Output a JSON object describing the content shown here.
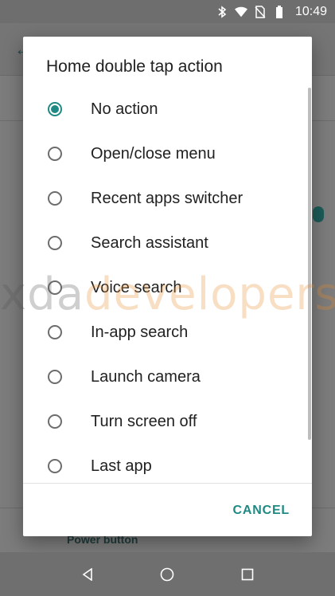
{
  "status_bar": {
    "time": "10:49",
    "icons": [
      "bluetooth-icon",
      "wifi-icon",
      "no-sim-icon",
      "battery-icon"
    ]
  },
  "background": {
    "power_label": "Power button",
    "watermark_left": "xda",
    "watermark_right": "developers"
  },
  "dialog": {
    "title": "Home double tap action",
    "options": [
      {
        "label": "No action",
        "selected": true
      },
      {
        "label": "Open/close menu",
        "selected": false
      },
      {
        "label": "Recent apps switcher",
        "selected": false
      },
      {
        "label": "Search assistant",
        "selected": false
      },
      {
        "label": "Voice search",
        "selected": false
      },
      {
        "label": "In-app search",
        "selected": false
      },
      {
        "label": "Launch camera",
        "selected": false
      },
      {
        "label": "Turn screen off",
        "selected": false
      },
      {
        "label": "Last app",
        "selected": false
      }
    ],
    "cancel_label": "CANCEL"
  },
  "nav_bar": {
    "icons": [
      "back-icon",
      "home-icon",
      "recents-icon"
    ]
  },
  "colors": {
    "accent": "#1f8a83",
    "scrim": "#7a7a7a"
  }
}
